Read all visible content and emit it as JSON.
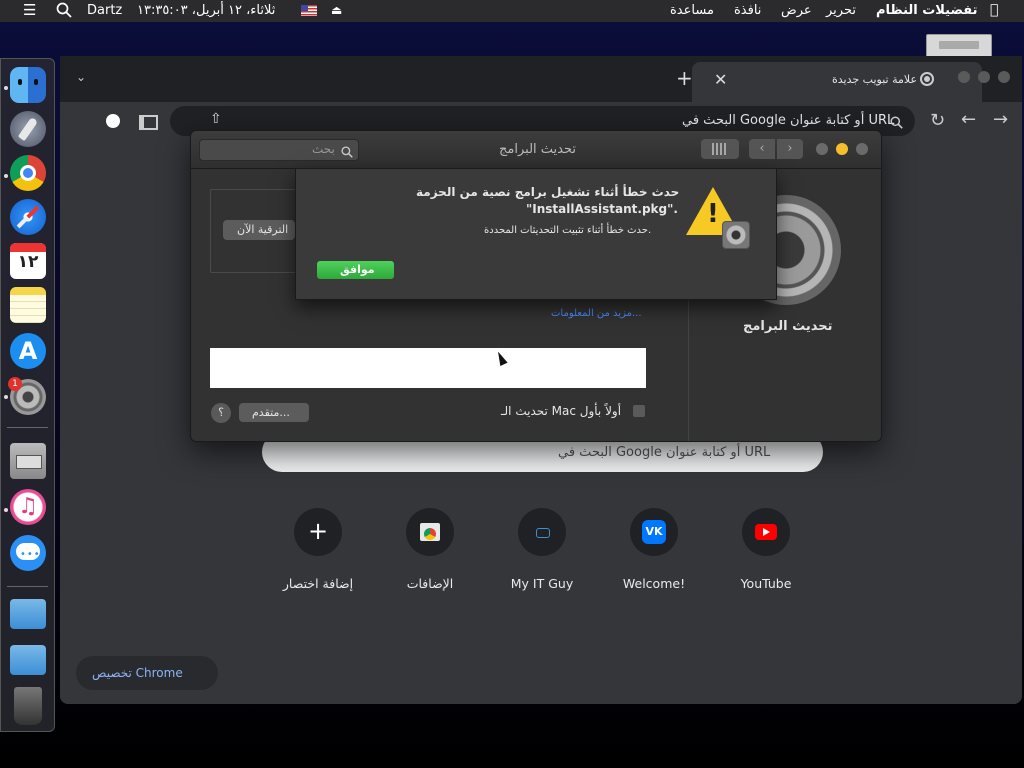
{
  "menubar": {
    "app_name": "تفضيلات النظام",
    "menus": [
      "تحرير",
      "عرض",
      "نافذة",
      "مساعدة"
    ],
    "username": "Dartz",
    "clock": "ثلاثاء، ١٢ أبريل، ١٣:٣٥:٠٣"
  },
  "browser": {
    "tab_title": "علامة تبويب جديدة",
    "omnibox_placeholder": "البحث في Google أو كتابة عنوان URL",
    "page_search_placeholder": "البحث في Google أو كتابة عنوان URL",
    "shortcuts": [
      {
        "label": "YouTube",
        "icon": "youtube-icon"
      },
      {
        "label": "Welcome!",
        "icon": "vk-icon"
      },
      {
        "label": "My IT Guy",
        "icon": "myitguy-icon"
      },
      {
        "label": "الإضافات",
        "icon": "web-store-icon"
      },
      {
        "label": "إضافة اختصار",
        "icon": "plus-icon"
      }
    ],
    "customize_label": "تخصيص Chrome"
  },
  "prefs": {
    "window_title": "تحديث البرامج",
    "search_placeholder": "بحث",
    "pane_label": "تحديث البرامج",
    "upgrade_button": "الترقية الآن",
    "more_info_link": "مزيد من المعلومات...",
    "auto_update_label": "تحديث الـ Mac أولاً بأول",
    "advanced_button": "متقدم...",
    "help_button": "؟"
  },
  "alert": {
    "title_line1": "حدث خطأ أثناء تشغيل برامج نصية من الحزمة",
    "title_line2": "\"InstallAssistant.pkg\".",
    "message": "حدث خطأ أثناء تثبيت التحديثات المحددة.",
    "ok_button": "موافق"
  },
  "dock": {
    "badge_count": "1",
    "calendar_day": "١٢"
  },
  "colors": {
    "accent_green": "#3cb94a",
    "link_blue": "#4c8dff",
    "youtube_red": "#ff0000",
    "vk_blue": "#0077ff"
  }
}
